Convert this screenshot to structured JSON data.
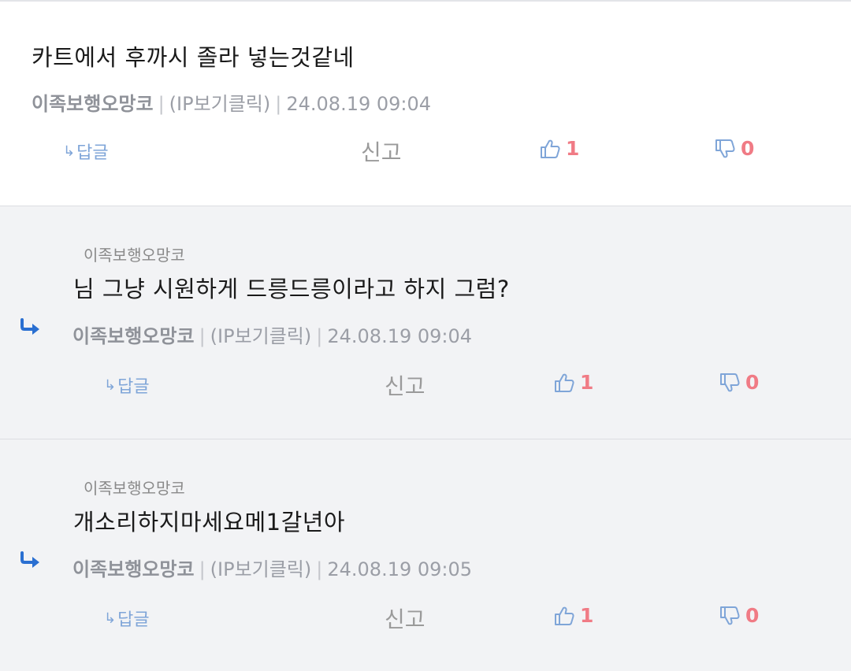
{
  "comments": [
    {
      "quoted_author": "",
      "text": "카트에서 후까시 졸라 넣는것같네",
      "author": "이족보행오망코",
      "ip": "(IP보기클릭)",
      "date": "24.08.19 09:04",
      "reply_label": "답글",
      "report_label": "신고",
      "likes": "1",
      "dislikes": "0"
    },
    {
      "quoted_author": "이족보행오망코",
      "text": "님 그냥 시원하게 드릉드릉이라고 하지 그럼?",
      "author": "이족보행오망코",
      "ip": "(IP보기클릭)",
      "date": "24.08.19 09:04",
      "reply_label": "답글",
      "report_label": "신고",
      "likes": "1",
      "dislikes": "0"
    },
    {
      "quoted_author": "이족보행오망코",
      "text": "개소리하지마세요메1갈년아",
      "author": "이족보행오망코",
      "ip": "(IP보기클릭)",
      "date": "24.08.19 09:05",
      "reply_label": "답글",
      "report_label": "신고",
      "likes": "1",
      "dislikes": "0"
    }
  ],
  "colors": {
    "reply_blue": "#7fa5d8",
    "arrow_blue": "#2a6fd1",
    "count_red": "#f07b85",
    "reply_bg": "#f2f3f5"
  },
  "icons": {
    "reply_marker": "reply-arrow-icon",
    "like": "thumbs-up-icon",
    "dislike": "thumbs-down-icon"
  }
}
